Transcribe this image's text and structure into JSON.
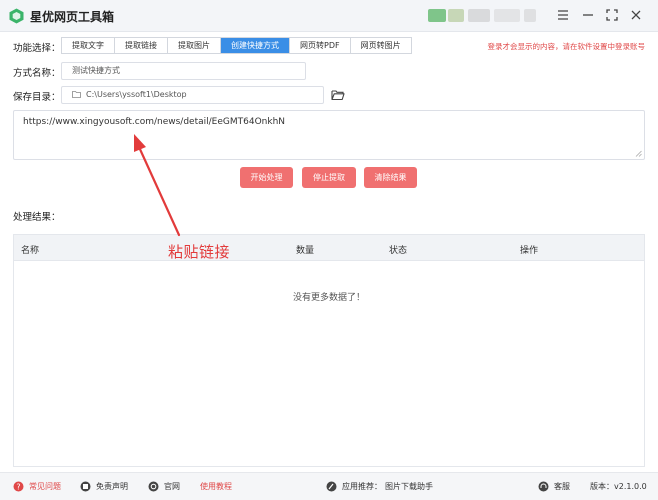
{
  "app": {
    "title": "星优网页工具箱",
    "version_label": "版本：",
    "version": "v2.1.0.0"
  },
  "window": {
    "minimize_icon": "minimize-icon",
    "maximize_icon": "maximize-icon",
    "close_icon": "close-icon",
    "menu_icon": "menu-icon"
  },
  "function_select": {
    "label": "功能选择：",
    "tabs": [
      {
        "label": "提取文字",
        "active": false
      },
      {
        "label": "提取链接",
        "active": false
      },
      {
        "label": "提取图片",
        "active": false
      },
      {
        "label": "创建快捷方式",
        "active": true
      },
      {
        "label": "网页转PDF",
        "active": false
      },
      {
        "label": "网页转图片",
        "active": false
      }
    ],
    "login_hint": "登录才会显示的内容，请在软件设置中登录账号"
  },
  "method_name": {
    "label": "方式名称：",
    "value": "测试快捷方式"
  },
  "save_dir": {
    "label": "保存目录：",
    "value": "C:\\Users\\yssoft1\\Desktop"
  },
  "url_input": {
    "value": "https://www.xingyousoft.com/news/detail/EeGMT64OnkhN"
  },
  "buttons": {
    "start": "开始处理",
    "stop": "停止提取",
    "clear": "清除结果"
  },
  "results": {
    "label": "处理结果：",
    "columns": [
      "名称",
      "数量",
      "状态",
      "操作"
    ],
    "empty_text": "没有更多数据了！"
  },
  "annotation": {
    "text": "粘贴链接",
    "color": "#e23b3b"
  },
  "statusbar": {
    "faq": "常见问题",
    "disclaimer": "免责声明",
    "website": "官网",
    "tutorial": "使用教程",
    "recommend_label": "应用推荐：",
    "recommend_app": "图片下载助手",
    "service": "客服"
  },
  "colors": {
    "accent": "#3a8ee6",
    "button": "#f07070",
    "warning": "#e04848"
  }
}
